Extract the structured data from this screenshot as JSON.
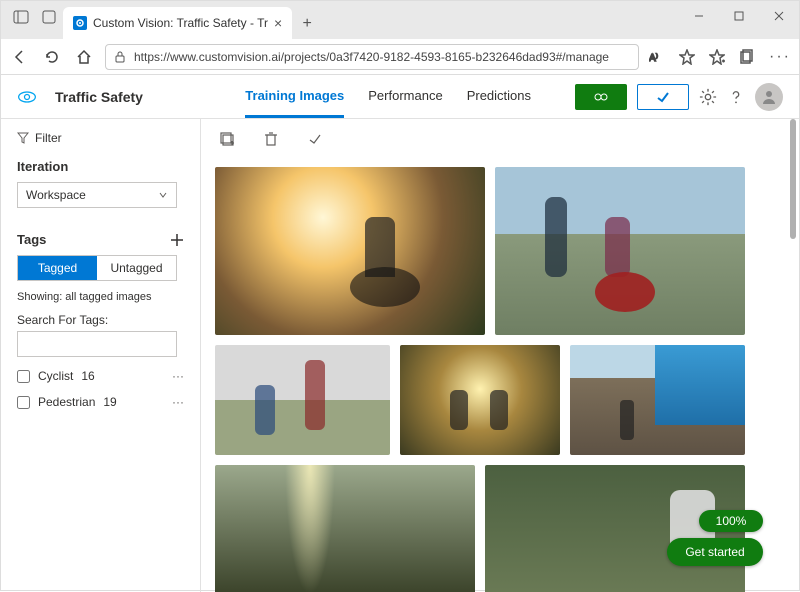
{
  "browser": {
    "tab_title": "Custom Vision: Traffic Safety - Tr",
    "url": "https://www.customvision.ai/projects/0a3f7420-9182-4593-8165-b232646dad93#/manage"
  },
  "header": {
    "project_name": "Traffic Safety",
    "tabs": {
      "training": "Training Images",
      "performance": "Performance",
      "predictions": "Predictions"
    }
  },
  "sidebar": {
    "filter_label": "Filter",
    "iteration_label": "Iteration",
    "iteration_value": "Workspace",
    "tags_label": "Tags",
    "toggle": {
      "tagged": "Tagged",
      "untagged": "Untagged"
    },
    "showing_text": "Showing: all tagged images",
    "search_label": "Search For Tags:",
    "tags": [
      {
        "name": "Cyclist",
        "count": "16"
      },
      {
        "name": "Pedestrian",
        "count": "19"
      }
    ]
  },
  "floating": {
    "progress": "100%",
    "get_started": "Get started"
  }
}
